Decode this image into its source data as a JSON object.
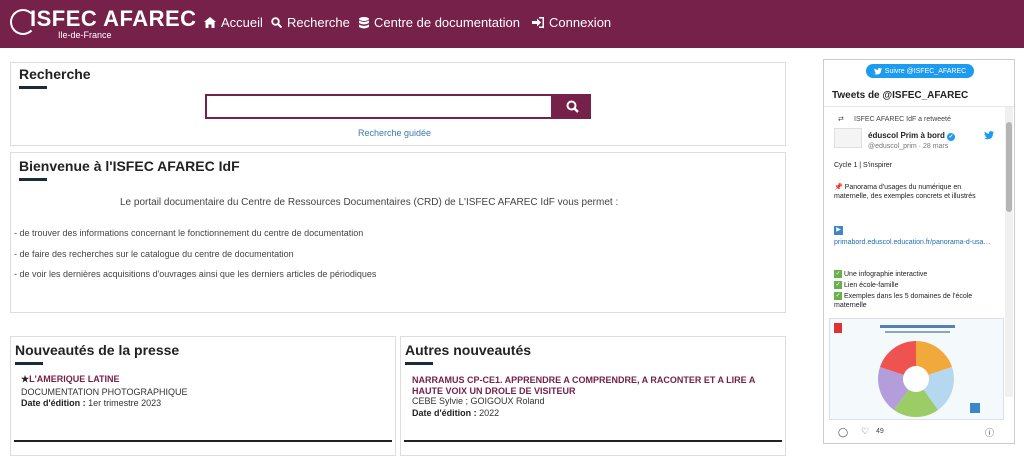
{
  "nav": {
    "brand": "ISFEC AFAREC",
    "brand_sub": "Ile-de-France",
    "items": [
      {
        "label": "Accueil",
        "icon": "home-icon"
      },
      {
        "label": "Recherche",
        "icon": "search-icon"
      },
      {
        "label": "Centre de documentation",
        "icon": "database-icon"
      },
      {
        "label": "Connexion",
        "icon": "sign-in-icon"
      }
    ]
  },
  "search": {
    "title": "Recherche",
    "value": "",
    "guided_link": "Recherche guidée"
  },
  "welcome": {
    "title": "Bienvenue à l'ISFEC AFAREC IdF",
    "intro": "Le portail documentaire du Centre de Ressources Documentaires (CRD) de L'ISFEC AFAREC IdF vous permet :",
    "bullets": [
      "- de trouver des informations concernant le fonctionnement du centre de documentation",
      "- de faire des recherches sur le catalogue du centre de documentation",
      "- de voir les dernières acquisitions d'ouvrages ainsi que les derniers articles de périodiques"
    ]
  },
  "press": {
    "title": "Nouveautés de la presse",
    "item": {
      "title": "L'AMERIQUE LATINE",
      "subtitle": "DOCUMENTATION PHOTOGRAPHIQUE",
      "date_label": "Date d'édition :",
      "date_value": "1er trimestre 2023"
    }
  },
  "other": {
    "title": "Autres nouveautés",
    "item": {
      "title": "NARRAMUS CP-CE1. APPRENDRE A COMPRENDRE, A RACONTER ET A LIRE A HAUTE VOIX UN DROLE DE VISITEUR",
      "authors": "CEBE Sylvie ; GOIGOUX Roland",
      "date_label": "Date d'édition :",
      "date_value": "2022"
    }
  },
  "twitter": {
    "follow_label": "Suivre @ISFEC_AFAREC",
    "heading": "Tweets de @ISFEC_AFAREC",
    "retweet_note": "ISFEC AFAREC IdF a retweeté",
    "author_name": "éduscol Prim à bord",
    "author_handle": "@eduscol_prim · 28 mars",
    "lines": [
      "Cycle 1 | S'inspirer",
      "📌 Panorama d'usages du numérique en maternelle, des exemples concrets et illustrés",
      "primabord.eduscol.education.fr/panorama-d-usa…",
      "Une infographie interactive",
      "Lien école-famille",
      "Exemples dans les 5 domaines de l'école maternelle"
    ],
    "likes": "49",
    "colors": {
      "accent": "#1d9bf0",
      "brand": "#76214a"
    }
  }
}
